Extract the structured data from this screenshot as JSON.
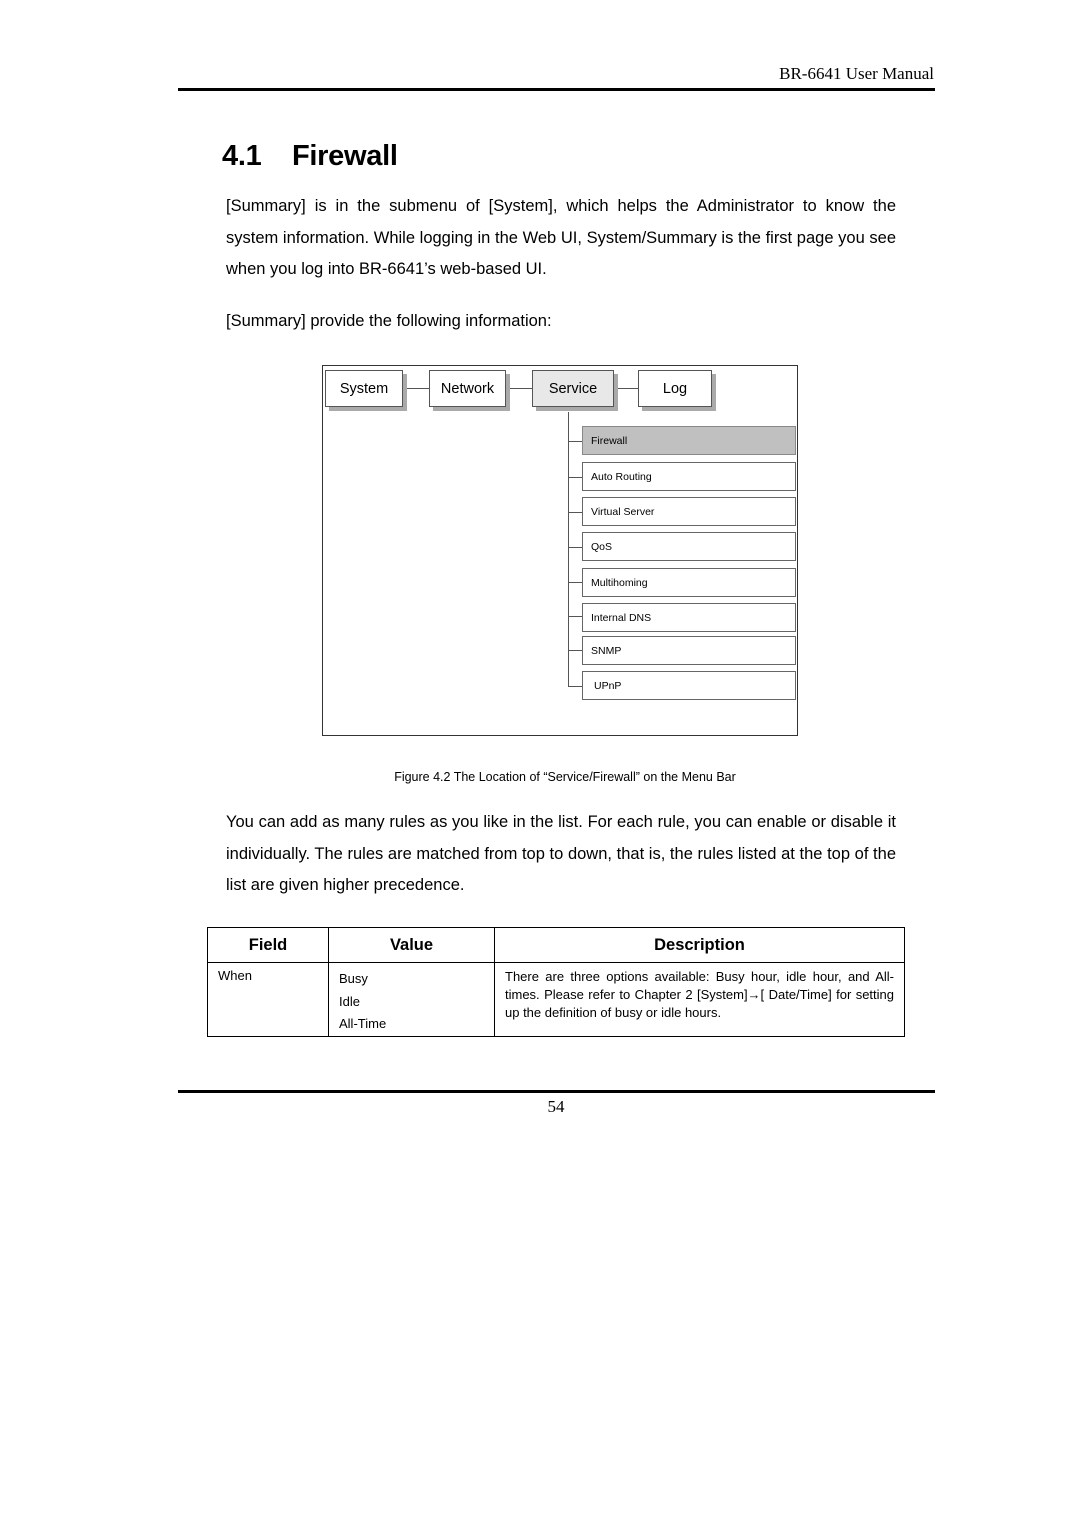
{
  "header": {
    "running_title": "BR-6641 User Manual"
  },
  "section": {
    "number": "4.1",
    "title": "Firewall"
  },
  "paragraphs": {
    "intro": "[Summary] is in the submenu of [System], which helps the Administrator to know the system information. While logging in the Web UI, System/Summary is the first page you see when you log into BR-6641’s web-based UI.",
    "provide": "[Summary] provide the following information:",
    "rules": "You can add as many rules as you like in the list. For each rule, you can enable or disable it individually. The rules are matched from top to down, that is, the rules listed at the top of the list are given higher precedence."
  },
  "diagram": {
    "menu": [
      "System",
      "Network",
      "Service",
      "Log"
    ],
    "active_menu": "Service",
    "submenu": [
      "Firewall",
      "Auto Routing",
      "Virtual Server",
      "QoS",
      "Multihoming",
      "Internal DNS",
      "SNMP",
      "UPnP"
    ],
    "active_submenu": "Firewall"
  },
  "figure_caption": "Figure 4.2 The Location of “Service/Firewall” on the Menu Bar",
  "table": {
    "headers": [
      "Field",
      "Value",
      "Description"
    ],
    "rows": [
      {
        "field": "When",
        "values": [
          "Busy",
          "Idle",
          "All-Time"
        ],
        "description": "There are three options available: Busy hour, idle hour, and All-times. Please refer to Chapter 2 [System]→[ Date/Time] for setting up the definition of busy or idle hours."
      }
    ]
  },
  "footer": {
    "page_number": "54"
  }
}
